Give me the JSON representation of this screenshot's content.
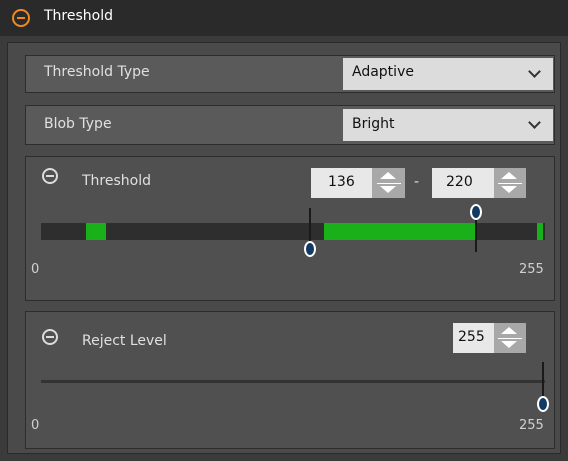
{
  "header": {
    "title": "Threshold"
  },
  "threshold_type": {
    "label": "Threshold Type",
    "value": "Adaptive"
  },
  "blob_type": {
    "label": "Blob Type",
    "value": "Bright"
  },
  "threshold_panel": {
    "title": "Threshold",
    "low_value": "136",
    "high_value": "220",
    "separator": "-",
    "min_label": "0",
    "max_label": "255",
    "low": 136,
    "high": 220,
    "green_color": "#1ab01a"
  },
  "reject_panel": {
    "title": "Reject Level",
    "value": "255",
    "min_label": "0",
    "max_label": "255",
    "level": 255
  },
  "colors": {
    "accent": "#f0891f",
    "handle": "#123a64"
  }
}
